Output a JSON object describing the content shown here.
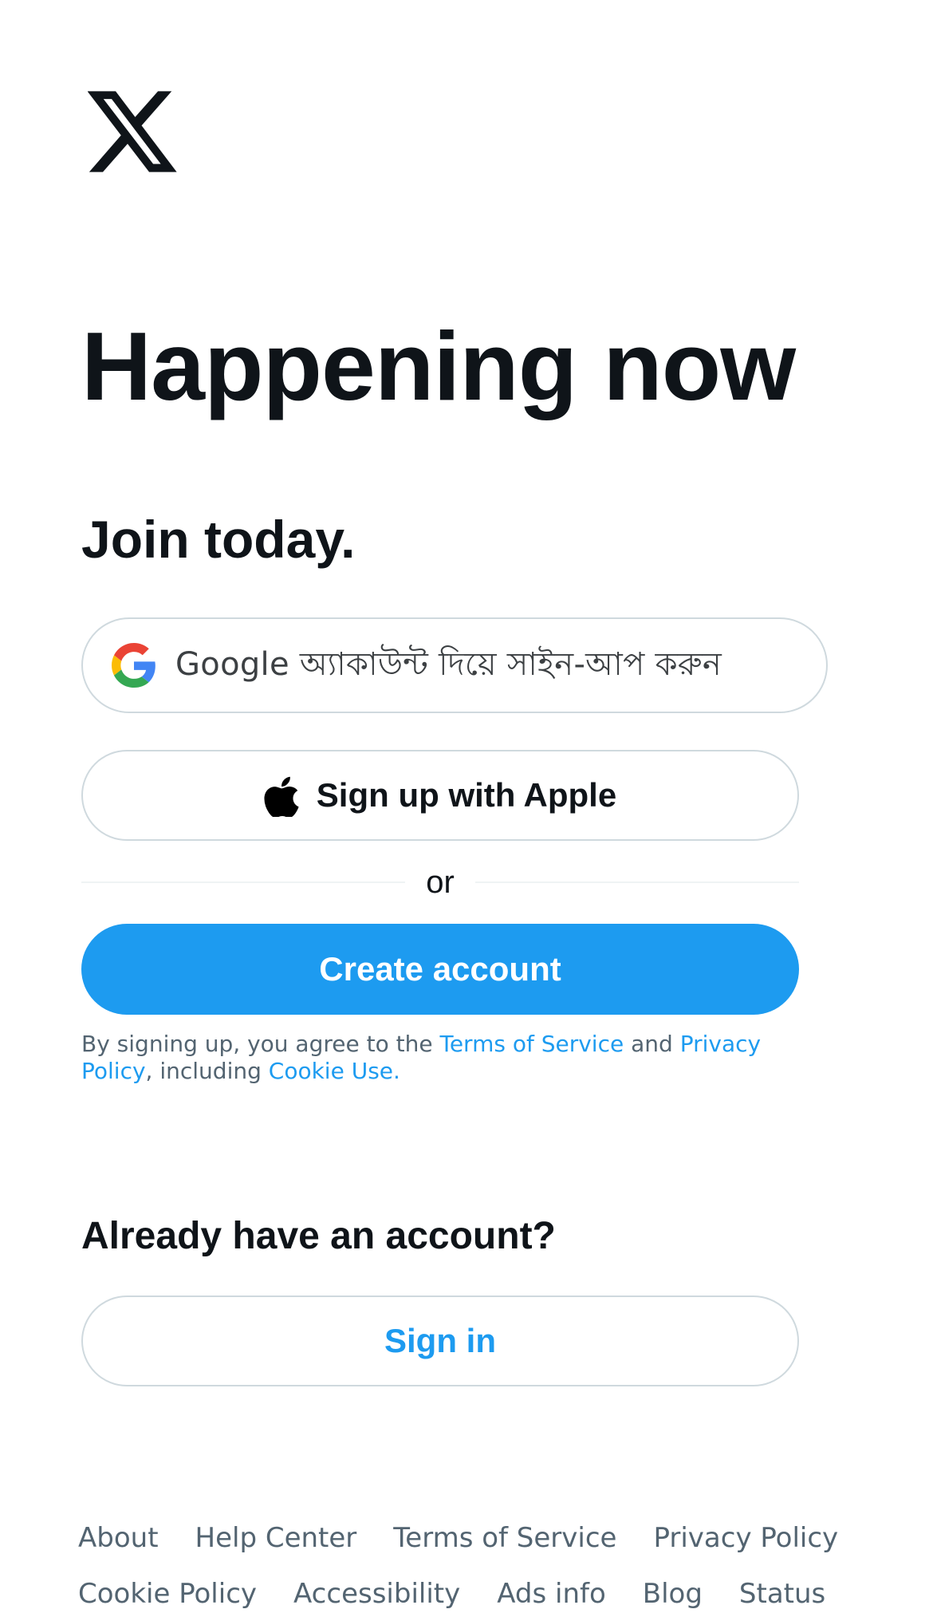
{
  "logo": {
    "icon": "x-logo-icon"
  },
  "headline": "Happening now",
  "subhead": "Join today.",
  "google_button": {
    "icon": "google-icon",
    "label": "Google অ্যাকাউন্ট দিয়ে সাইন-আপ করুন"
  },
  "apple_button": {
    "icon": "apple-icon",
    "label": "Sign up with Apple"
  },
  "divider_text": "or",
  "create_button": {
    "label": "Create account",
    "color": "#1d9bf0"
  },
  "legal": {
    "prefix": "By signing up, you agree to the ",
    "terms": "Terms of Service",
    "and": " and ",
    "privacy": "Privacy Policy",
    "including": ", including ",
    "cookie": "Cookie Use."
  },
  "already": "Already have an account?",
  "signin_button": {
    "label": "Sign in"
  },
  "footer": {
    "links": [
      "About",
      "Help Center",
      "Terms of Service",
      "Privacy Policy",
      "Cookie Policy",
      "Accessibility",
      "Ads info",
      "Blog",
      "Status"
    ]
  },
  "colors": {
    "text": "#0f1419",
    "secondary": "#536471",
    "accent": "#1d9bf0",
    "border": "#cfd9de"
  }
}
